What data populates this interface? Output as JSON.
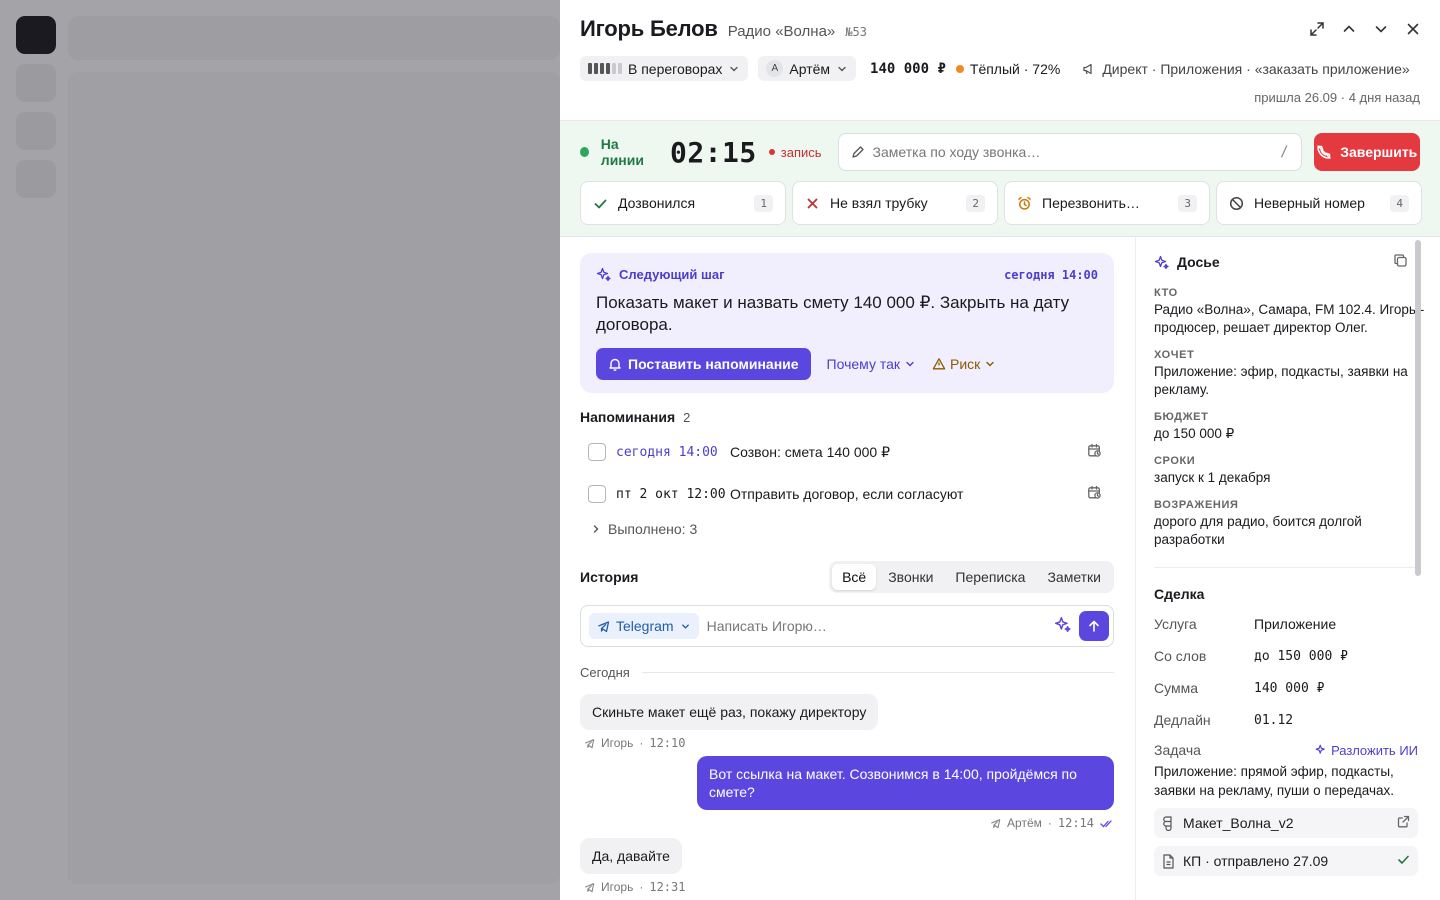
{
  "lead": {
    "name": "Игорь Белов",
    "company": "Радио «Волна»",
    "number": "№53",
    "stage": "В переговорах",
    "owner_initial": "А",
    "owner": "Артём",
    "amount": "140 000 ₽",
    "temperature": "Тёплый · 72%",
    "temperature_color": "#f08a24",
    "source": "Директ · Приложения · «заказать приложение»",
    "arrived": "пришла 26.09 · 4 дня назад"
  },
  "call": {
    "status": "На линии",
    "timer": "02:15",
    "recording": "запись",
    "note_placeholder": "Заметка по ходу звонка…",
    "note_shortcut": "/",
    "end_label": "Завершить",
    "outcomes": [
      {
        "label": "Дозвонился",
        "key": "1",
        "icon": "check-icon"
      },
      {
        "label": "Не взял трубку",
        "key": "2",
        "icon": "x-icon"
      },
      {
        "label": "Перезвонить…",
        "key": "3",
        "icon": "alarm-icon"
      },
      {
        "label": "Неверный номер",
        "key": "4",
        "icon": "ban-icon"
      }
    ]
  },
  "next_step": {
    "heading": "Следующий шаг",
    "time": "сегодня 14:00",
    "text": "Показать макет и назвать смету 140 000 ₽. Закрыть на дату договора.",
    "remind_label": "Поставить напоминание",
    "why_label": "Почему так",
    "risk_label": "Риск"
  },
  "reminders": {
    "title": "Напоминания",
    "count": "2",
    "items": [
      {
        "date": "сегодня 14:00",
        "text": "Созвон: смета 140 000 ₽"
      },
      {
        "date": "пт 2 окт 12:00",
        "text": "Отправить договор, если согласуют"
      }
    ],
    "done_label": "Выполнено: 3"
  },
  "history": {
    "title": "История",
    "tabs": [
      "Всё",
      "Звонки",
      "Переписка",
      "Заметки"
    ],
    "active_tab": "Всё",
    "channel": "Telegram",
    "composer_placeholder": "Написать Игорю…",
    "day": "Сегодня",
    "messages": [
      {
        "dir": "in",
        "text": "Скиньте макет ещё раз, покажу директору",
        "author": "Игорь",
        "time": "12:10"
      },
      {
        "dir": "out",
        "text": "Вот ссылка на макет. Созвонимся в 14:00, пройдёмся по смете?",
        "author": "Артём",
        "time": "12:14"
      },
      {
        "dir": "in",
        "text": "Да, давайте",
        "author": "Игорь",
        "time": "12:31"
      }
    ]
  },
  "dossier": {
    "title": "Досье",
    "fields": [
      {
        "label": "КТО",
        "value": "Радио «Волна», Самара, FM 102.4. Игорь - продюсер, решает директор Олег."
      },
      {
        "label": "ХОЧЕТ",
        "value": "Приложение: эфир, подкасты, заявки на рекламу."
      },
      {
        "label": "БЮДЖЕТ",
        "value": "до 150 000 ₽"
      },
      {
        "label": "СРОКИ",
        "value": "запуск к 1 декабря"
      },
      {
        "label": "ВОЗРАЖЕНИЯ",
        "value": "дорого для радио, боится долгой разработки"
      }
    ]
  },
  "deal": {
    "title": "Сделка",
    "rows": [
      {
        "k": "Услуга",
        "v": "Приложение",
        "mono": false
      },
      {
        "k": "Со слов",
        "v": "до 150 000 ₽",
        "mono": true
      },
      {
        "k": "Сумма",
        "v": "140 000 ₽",
        "mono": true
      },
      {
        "k": "Дедлайн",
        "v": "01.12",
        "mono": true
      }
    ],
    "task_label": "Задача",
    "ai_label": "Разложить ИИ",
    "task_text": "Приложение: прямой эфир, подкасты, заявки на рекламу, пуши о передачах.",
    "files": [
      {
        "name": "Макет_Волна_v2",
        "icon": "figma-icon",
        "action": "external-link-icon"
      },
      {
        "name": "КП · отправлено 27.09",
        "icon": "document-icon",
        "action": "check-icon"
      }
    ]
  },
  "colors": {
    "accent": "#5b46e0",
    "danger": "#e4393f",
    "online": "#2da660",
    "call_bg": "#eef8f1"
  }
}
